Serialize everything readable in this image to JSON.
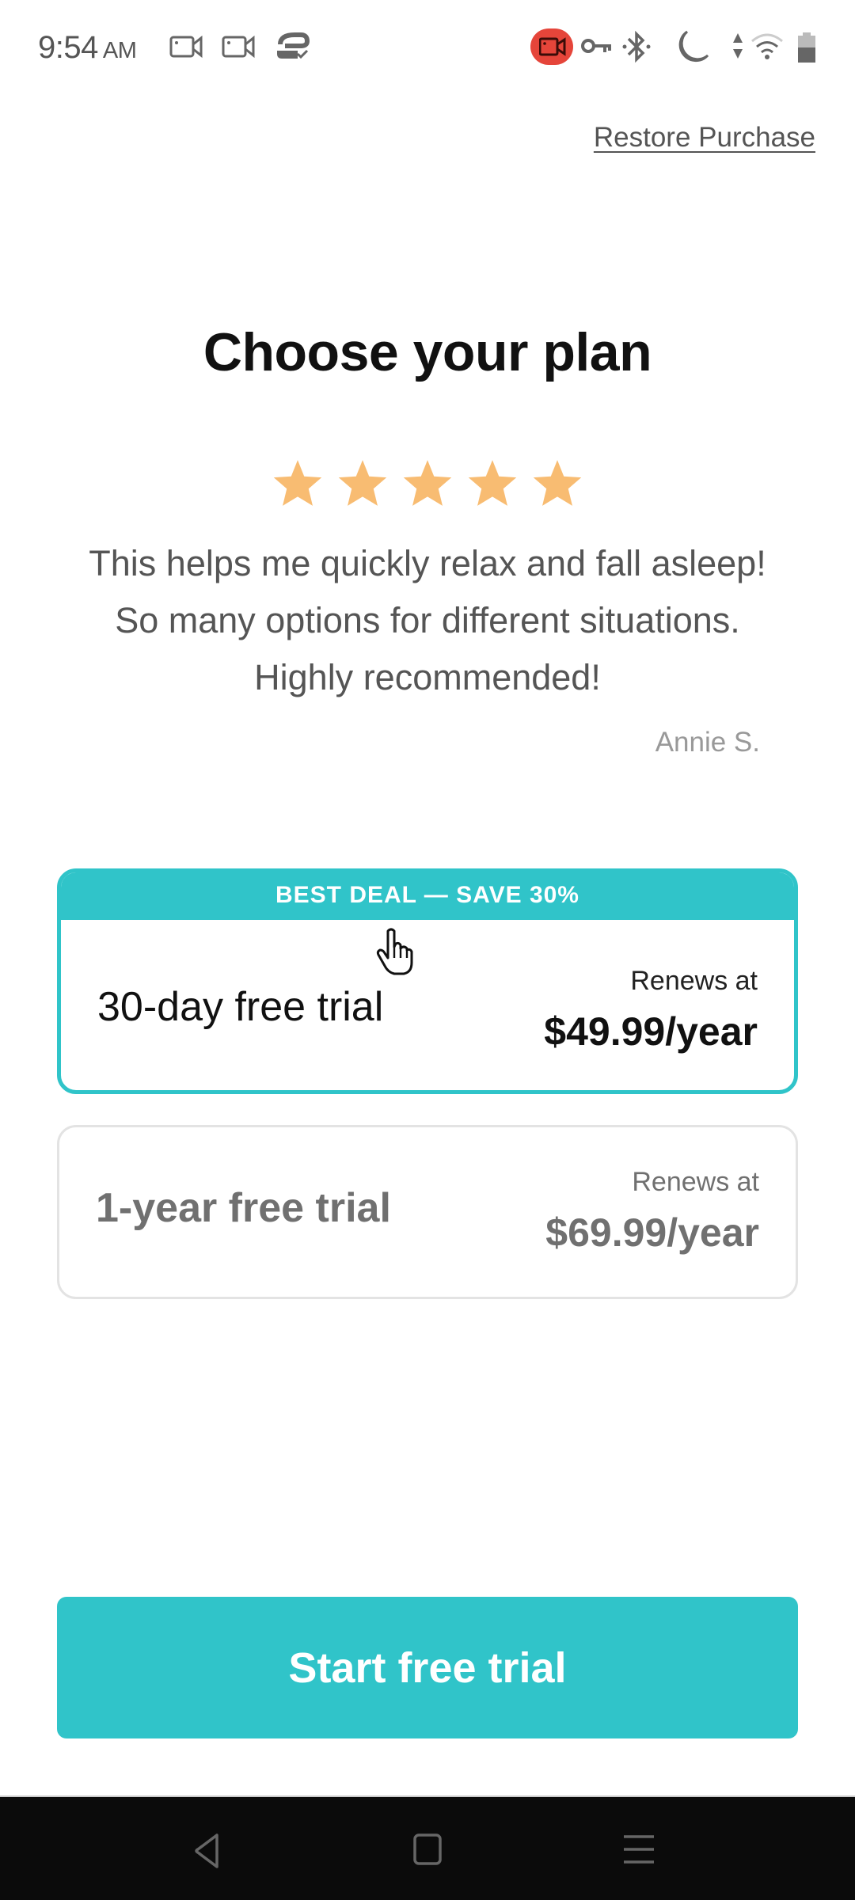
{
  "status_bar": {
    "time": "9:54",
    "ampm": "AM",
    "left_icons": [
      "screen-record-icon",
      "screen-record-icon",
      "sync-check-icon"
    ],
    "right_icons": [
      "recording-active-icon",
      "vpn-key-icon",
      "bluetooth-icon",
      "do-not-disturb-moon-icon",
      "data-arrows-icon",
      "wifi-icon",
      "battery-icon"
    ],
    "recording_color": "#e5453a"
  },
  "header": {
    "restore_purchase_label": "Restore Purchase"
  },
  "main": {
    "title": "Choose your plan",
    "rating": {
      "stars": 5,
      "max": 5,
      "color": "#f8bc72"
    },
    "review": {
      "text": "This helps me quickly relax and fall asleep! So many options for different situations. Highly recommended!",
      "author": "Annie S."
    },
    "plans": [
      {
        "banner": "BEST DEAL — SAVE 30%",
        "name": "30-day free trial",
        "renews_label": "Renews at",
        "price": "$49.99/year",
        "selected": true
      },
      {
        "banner": "",
        "name": "1-year free trial",
        "renews_label": "Renews at",
        "price": "$69.99/year",
        "selected": false
      }
    ],
    "cta_label": "Start free trial"
  },
  "colors": {
    "accent": "#30c4c9",
    "star": "#f8bc72",
    "nav_bar": "#0b0b0b"
  },
  "nav_bar": {
    "buttons": [
      "back-icon",
      "home-icon",
      "recents-icon"
    ]
  }
}
